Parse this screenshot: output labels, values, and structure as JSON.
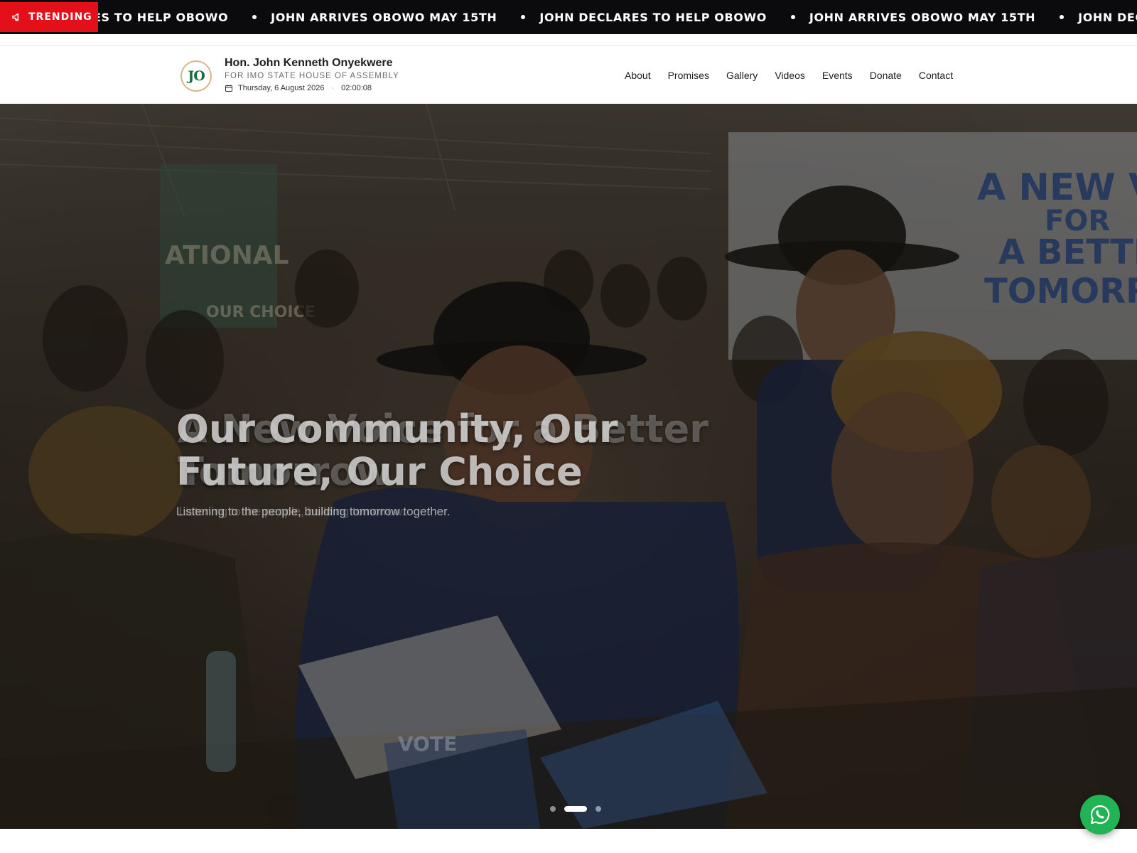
{
  "ticker": {
    "badge_label": "TRENDING",
    "items": [
      "ES TO HELP OBOWO",
      "JOHN ARRIVES OBOWO MAY 15TH",
      "JOHN DECLARES TO HELP OBOWO",
      "JOHN ARRIVES OBOWO MAY 15TH",
      "JOHN DECLARES TO HELP OBOWO"
    ]
  },
  "header": {
    "logo_text": "JO",
    "name": "Hon. John Kenneth Onyekwere",
    "subtitle": "FOR IMO STATE HOUSE OF ASSEMBLY",
    "date": "Thursday, 6 August 2026",
    "time": "02:00:08",
    "nav": [
      "About",
      "Promises",
      "Gallery",
      "Videos",
      "Events",
      "Donate",
      "Contact"
    ]
  },
  "hero": {
    "title_line1": "Our Community, Our",
    "title_line2": "Future, Our Choice",
    "ghost_line1": "A New Voice for a Better",
    "ghost_line2": "Tomorrow",
    "subtitle": "Listening to the people, building tomorrow together.",
    "ghost_subtitle": "Listening to the people, building tomorrow.",
    "banner_text_1": "A NEW VOICE",
    "banner_text_2": "FOR",
    "banner_text_3": "A BETTER",
    "banner_text_4": "TOMORROW",
    "poster_text_1": "ATIONAL",
    "poster_text_2": "OUR CHOICE",
    "vote_text": "VOTE",
    "slides": 3,
    "active_slide": 2
  },
  "colors": {
    "ticker_bg": "#0b0b0d",
    "trending_red": "#e3101a",
    "logo_green": "#1c6b3f",
    "whatsapp_green": "#22b354"
  },
  "icons": {
    "trending": "megaphone-icon",
    "date": "calendar-icon",
    "whatsapp": "whatsapp-icon"
  }
}
